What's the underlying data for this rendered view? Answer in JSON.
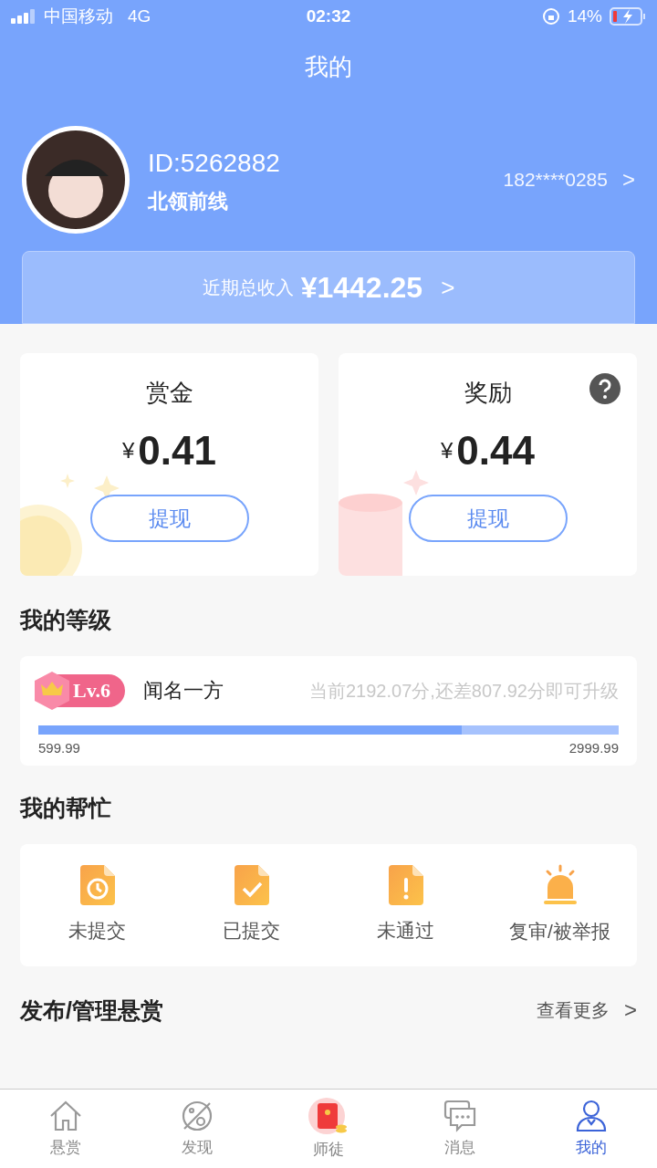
{
  "status_bar": {
    "carrier": "中国移动",
    "network": "4G",
    "time": "02:32",
    "battery": "14%"
  },
  "title": "我的",
  "profile": {
    "id": "ID:5262882",
    "name": "北领前线",
    "phone": "182****0285",
    "chevron": ">"
  },
  "income": {
    "label": "近期总收入",
    "amount": "¥1442.25",
    "chevron": ">"
  },
  "wallets": [
    {
      "kind": "coin",
      "title": "赏金",
      "currency": "¥",
      "amount": "0.41",
      "button": "提现",
      "help": false
    },
    {
      "kind": "envelope",
      "title": "奖励",
      "currency": "¥",
      "amount": "0.44",
      "button": "提现",
      "help": true
    }
  ],
  "level_section": {
    "title": "我的等级",
    "badge": "Lv.6",
    "rank": "闻名一方",
    "hint": "当前2192.07分,还差807.92分即可升级",
    "level": 0.73,
    "min": "599.99",
    "max": "2999.99"
  },
  "help_section": {
    "title": "我的帮忙",
    "items": [
      {
        "kind": "clock",
        "label": "未提交"
      },
      {
        "kind": "check",
        "label": "已提交"
      },
      {
        "kind": "alert",
        "label": "未通过"
      },
      {
        "kind": "siren",
        "label": "复审/被举报"
      }
    ]
  },
  "publish_row": {
    "title": "发布/管理悬赏",
    "more": "查看更多",
    "chevron": ">"
  },
  "tabs": [
    {
      "kind": "home",
      "label": "悬赏",
      "selected": false
    },
    {
      "kind": "planet",
      "label": "发现",
      "selected": false
    },
    {
      "kind": "envelope",
      "label": "师徒",
      "selected": false
    },
    {
      "kind": "chat",
      "label": "消息",
      "selected": false
    },
    {
      "kind": "person",
      "label": "我的",
      "selected": true
    }
  ]
}
